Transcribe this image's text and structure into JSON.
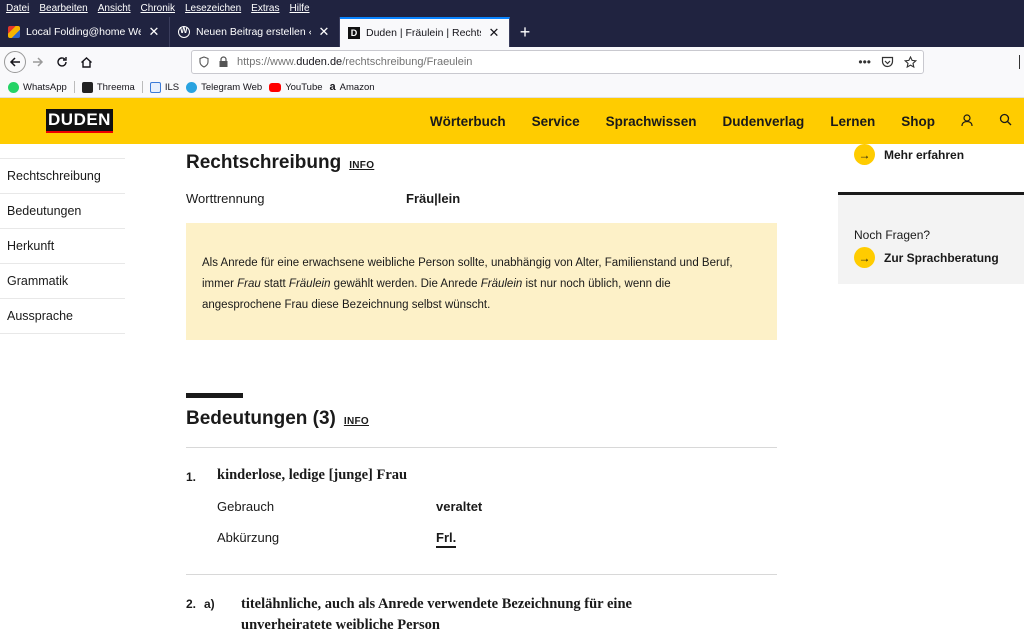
{
  "menu": [
    "Datei",
    "Bearbeiten",
    "Ansicht",
    "Chronik",
    "Lesezeichen",
    "Extras",
    "Hilfe"
  ],
  "tabs": [
    {
      "title": "Local Folding@home Web Con",
      "favicon": "folding-icon"
    },
    {
      "title": "Neuen Beitrag erstellen ‹ Penni",
      "favicon": "wordpress-icon"
    },
    {
      "title": "Duden | Fräulein | Rechtschreib",
      "favicon": "duden-icon",
      "active": true
    }
  ],
  "newtab": "+",
  "url": {
    "prefix": "https://www.",
    "domain": "duden.de",
    "path": "/rechtschreibung/Fraeulein"
  },
  "bookmarks": [
    "WhatsApp",
    "Threema",
    "ILS",
    "Telegram Web",
    "YouTube",
    "Amazon"
  ],
  "site": {
    "logo": "DUDEN",
    "nav": [
      "Wörterbuch",
      "Service",
      "Sprachwissen",
      "Dudenverlag",
      "Lernen",
      "Shop"
    ],
    "accent": "#ffcc00"
  },
  "sidebar": [
    "Rechtschreibung",
    "Bedeutungen",
    "Herkunft",
    "Grammatik",
    "Aussprache"
  ],
  "rechtschreibung": {
    "title": "Rechtschreibung",
    "info": "INFO",
    "key": "Worttrennung",
    "value": "Fräu|lein"
  },
  "notice": {
    "p1": "Als Anrede für eine erwachsene weibliche Person sollte, unabhängig von Alter, Familienstand und Beruf,",
    "p2a": "immer ",
    "p2b": "Frau",
    "p2c": " statt ",
    "p2d": "Fräulein",
    "p2e": " gewählt werden. Die Anrede ",
    "p2f": "Fräulein",
    "p2g": " ist nur noch üblich, wenn die",
    "p3": "angesprochene Frau diese Bezeichnung selbst wünscht."
  },
  "bedeutungen": {
    "title": "Bedeutungen (3)",
    "info": "INFO",
    "m1": {
      "num": "1.",
      "def": "kinderlose, ledige [junge] Frau",
      "rows": [
        {
          "key": "Gebrauch",
          "value": "veraltet"
        },
        {
          "key": "Abkürzung",
          "value": "Frl."
        }
      ]
    },
    "m2": {
      "num": "2.",
      "sub": "a)",
      "def1": "titelähnliche, auch als Anrede verwendete Bezeichnung für eine",
      "def2": "unverheiratete weibliche Person"
    }
  },
  "aside": {
    "more": "Mehr erfahren",
    "question": "Noch Fragen?",
    "link": "Zur Sprachberatung"
  }
}
